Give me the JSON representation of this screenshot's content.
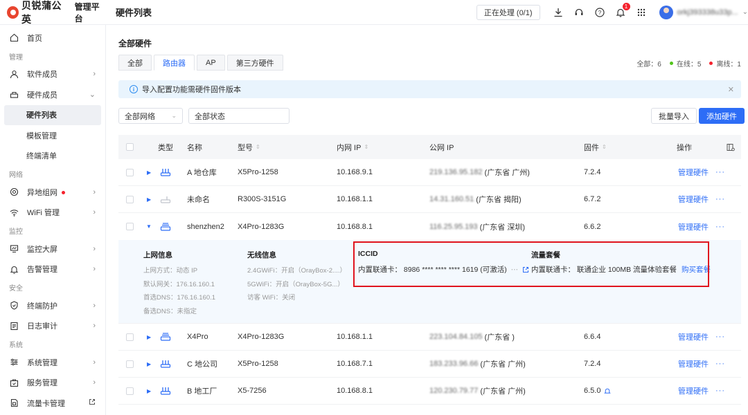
{
  "brand": {
    "name": "贝锐蒲公英",
    "subtitle": "管理平台"
  },
  "header": {
    "page_title": "硬件列表",
    "processing": "正在处理 (0/1)",
    "bell_count": "1",
    "user_name": "orkj393338u33p..."
  },
  "sidebar": {
    "home": "首页",
    "group_manage": "管理",
    "software_members": "软件成员",
    "hardware_members": "硬件成员",
    "hardware_list": "硬件列表",
    "template_manage": "模板管理",
    "terminal_list": "终端清单",
    "group_network": "网络",
    "remote_network": "异地组网",
    "wifi_manage": "WiFi 管理",
    "group_monitor": "监控",
    "monitor_screen": "监控大屏",
    "alert_manage": "告警管理",
    "group_security": "安全",
    "terminal_protect": "终端防护",
    "log_audit": "日志审计",
    "group_system": "系统",
    "system_manage": "系统管理",
    "service_manage": "服务管理",
    "sim_manage": "流量卡管理"
  },
  "main": {
    "section_title": "全部硬件",
    "tabs": [
      "全部",
      "路由器",
      "AP",
      "第三方硬件"
    ],
    "counts": {
      "all": "全部：6",
      "online": "在线：5",
      "offline": "离线：1"
    },
    "notice": "导入配置功能需硬件固件版本",
    "filter_network": "全部网络",
    "filter_status": "全部状态",
    "btn_import": "批量导入",
    "btn_add": "添加硬件"
  },
  "table": {
    "headers": {
      "type": "类型",
      "name": "名称",
      "model": "型号",
      "lan_ip": "内网 IP",
      "wan_ip": "公网 IP",
      "firmware": "固件",
      "action": "操作"
    },
    "manage_label": "管理硬件",
    "rows": [
      {
        "name": "A 地仓库",
        "model": "X5Pro-1258",
        "lan_ip": "10.168.9.1",
        "wan_ip_masked": "219.136.95.182",
        "wan_loc": "(广东省 广州)",
        "firmware": "7.2.4"
      },
      {
        "name": "未命名",
        "model": "R300S-3151G",
        "lan_ip": "10.168.1.1",
        "wan_ip_masked": "14.31.160.51",
        "wan_loc": "(广东省 揭阳)",
        "firmware": "6.7.2"
      },
      {
        "name": "shenzhen2",
        "model": "X4Pro-1283G",
        "lan_ip": "10.168.8.1",
        "wan_ip_masked": "116.25.95.193",
        "wan_loc": "(广东省 深圳)",
        "firmware": "6.6.2"
      },
      {
        "name": "X4Pro",
        "model": "X4Pro-1283G",
        "lan_ip": "10.168.1.1",
        "wan_ip_masked": "223.104.84.105",
        "wan_loc": "(广东省 )",
        "firmware": "6.6.4"
      },
      {
        "name": "C 地公司",
        "model": "X5Pro-1258",
        "lan_ip": "10.168.7.1",
        "wan_ip_masked": "183.233.96.66",
        "wan_loc": "(广东省 广州)",
        "firmware": "7.2.4"
      },
      {
        "name": "B 地工厂",
        "model": "X5-7256",
        "lan_ip": "10.168.8.1",
        "wan_ip_masked": "120.230.79.77",
        "wan_loc": "(广东省 广州)",
        "firmware": "6.5.0"
      }
    ],
    "expand": {
      "lan_title": "上网信息",
      "lan_lines": [
        "上网方式：动态 IP",
        "默认网关：176.16.160.1",
        "首选DNS：176.16.160.1",
        "备选DNS：未指定"
      ],
      "wifi_title": "无线信息",
      "wifi_lines": [
        "2.4GWiFi：开启（OrayBox-2....）",
        "5GWiFi：开启（OrayBox-5G...）",
        "访客 WiFi：关闭"
      ],
      "iccid_title": "ICCID",
      "iccid_value": "内置联通卡： 8986 **** **** **** 1619 (可激活)",
      "plan_title": "流量套餐",
      "plan_value": "内置联通卡： 联通企业 100MB 流量体验套餐",
      "plan_buy": "购买套餐"
    }
  }
}
